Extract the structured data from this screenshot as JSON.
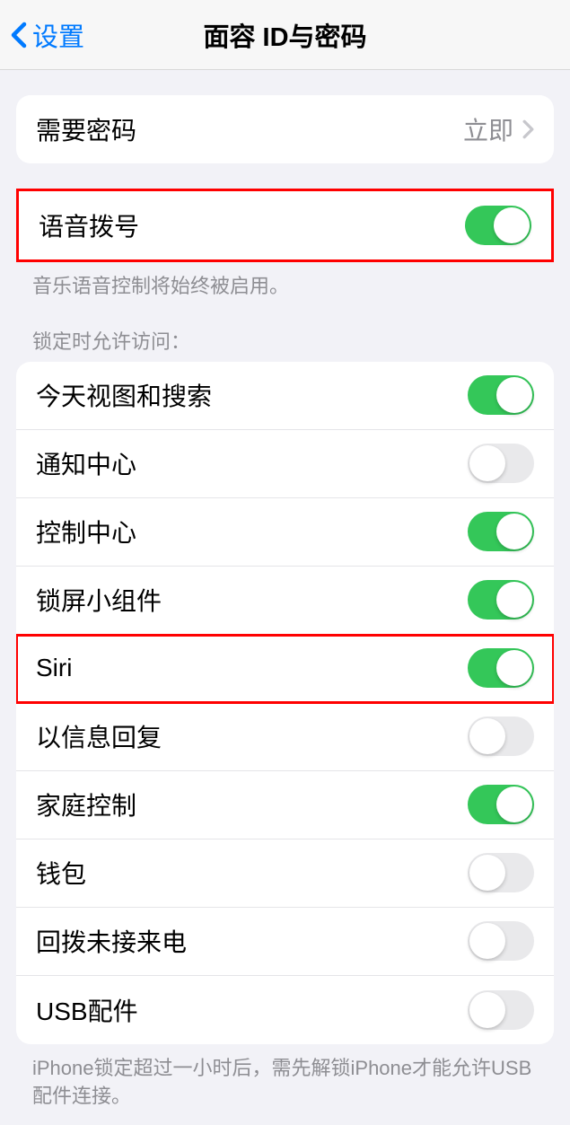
{
  "navbar": {
    "back_label": "设置",
    "title": "面容 ID与密码"
  },
  "require_passcode": {
    "label": "需要密码",
    "value": "立即"
  },
  "voice_dial": {
    "label": "语音拨号",
    "enabled": true,
    "footer": "音乐语音控制将始终被启用。"
  },
  "lock_section": {
    "header": "锁定时允许访问：",
    "items": [
      {
        "label": "今天视图和搜索",
        "enabled": true,
        "highlight": false
      },
      {
        "label": "通知中心",
        "enabled": false,
        "highlight": false
      },
      {
        "label": "控制中心",
        "enabled": true,
        "highlight": false
      },
      {
        "label": "锁屏小组件",
        "enabled": true,
        "highlight": false
      },
      {
        "label": "Siri",
        "enabled": true,
        "highlight": true
      },
      {
        "label": "以信息回复",
        "enabled": false,
        "highlight": false
      },
      {
        "label": "家庭控制",
        "enabled": true,
        "highlight": false
      },
      {
        "label": "钱包",
        "enabled": false,
        "highlight": false
      },
      {
        "label": "回拨未接来电",
        "enabled": false,
        "highlight": false
      },
      {
        "label": "USB配件",
        "enabled": false,
        "highlight": false
      }
    ],
    "footer": "iPhone锁定超过一小时后，需先解锁iPhone才能允许USB配件连接。"
  }
}
